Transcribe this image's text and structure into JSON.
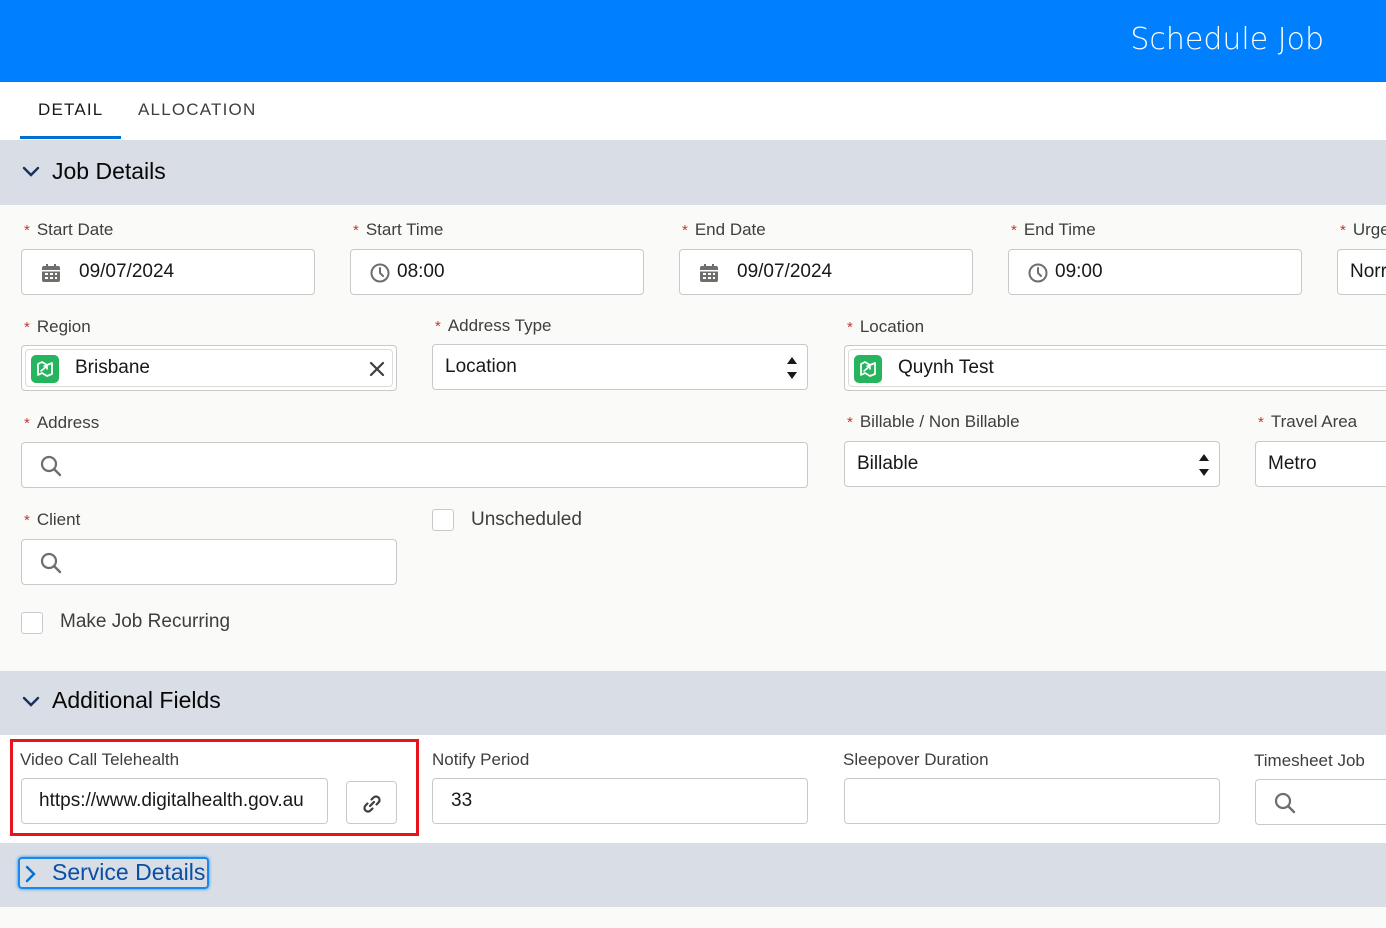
{
  "header": {
    "title": "Schedule Job"
  },
  "tabs": [
    {
      "label": "DETAIL"
    },
    {
      "label": "ALLOCATION"
    }
  ],
  "sections": {
    "job_details": "Job Details",
    "additional_fields": "Additional Fields",
    "service_details": "Service Details"
  },
  "required_marker": "*",
  "fields": {
    "start_date": {
      "label": "Start Date",
      "value": "09/07/2024"
    },
    "start_time": {
      "label": "Start Time",
      "value": "08:00"
    },
    "end_date": {
      "label": "End Date",
      "value": "09/07/2024"
    },
    "end_time": {
      "label": "End Time",
      "value": "09:00"
    },
    "urgency": {
      "label": "Urge",
      "value": "Norr"
    },
    "region": {
      "label": "Region",
      "value": "Brisbane"
    },
    "address_type": {
      "label": "Address Type",
      "value": "Location"
    },
    "location": {
      "label": "Location",
      "value": "Quynh Test"
    },
    "address": {
      "label": "Address",
      "value": ""
    },
    "billable": {
      "label": "Billable / Non Billable",
      "value": "Billable"
    },
    "travel_area": {
      "label": "Travel Area",
      "value": "Metro"
    },
    "client": {
      "label": "Client",
      "value": ""
    },
    "unscheduled": {
      "label": "Unscheduled",
      "checked": false
    },
    "recurring": {
      "label": "Make Job Recurring",
      "checked": false
    },
    "video_call": {
      "label": "Video Call Telehealth",
      "value": "https://www.digitalhealth.gov.au"
    },
    "notify_period": {
      "label": "Notify Period",
      "value": "33"
    },
    "sleepover": {
      "label": "Sleepover Duration",
      "value": ""
    },
    "timesheet_job": {
      "label": "Timesheet Job",
      "value": ""
    }
  },
  "colors": {
    "brand_header": "#0080ff",
    "section_bar": "#d8dde6",
    "required": "#c23934",
    "highlight": "#e8141c",
    "record_icon": "#27b45f"
  },
  "icons": [
    "chevron-down-icon",
    "chevron-right-icon",
    "calendar-icon",
    "clock-icon",
    "search-icon",
    "close-icon",
    "link-icon",
    "sort-arrows-icon",
    "record-icon"
  ]
}
